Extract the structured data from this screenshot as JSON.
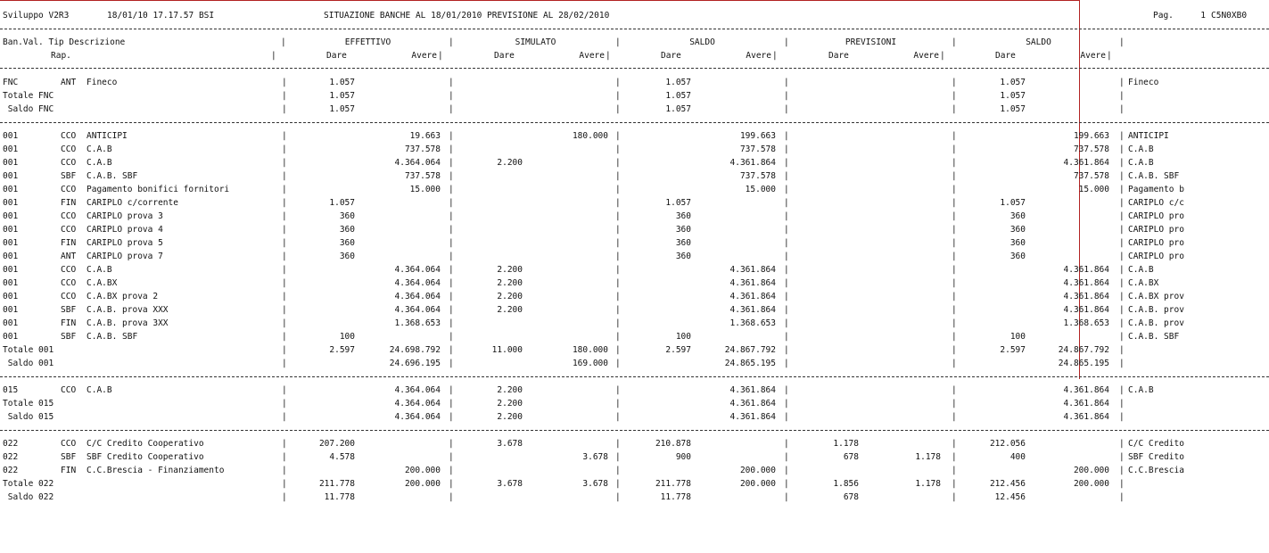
{
  "header": {
    "env": "Sviluppo V2R3",
    "datetime": "18/01/10 17.17.57 BSI",
    "title": "SITUAZIONE BANCHE AL 18/01/2010 PREVISIONE AL 28/02/2010",
    "page_label": "Pag.",
    "page_number": "1",
    "program_code": "C5N0XB0"
  },
  "columns": {
    "ban_val_tip_descr": "Ban.Val. Tip Descrizione",
    "rap": "Rap.",
    "effettivo": "EFFETTIVO",
    "simulato": "SIMULATO",
    "saldo1": "SALDO",
    "previsioni": "PREVISIONI",
    "saldo2": "SALDO",
    "dare": "Dare",
    "avere": "Avere"
  },
  "groups": [
    {
      "rows": [
        {
          "ban": "FNC",
          "tip": "ANT",
          "desc": "Fineco",
          "e_d": "1.057",
          "e_a": "",
          "s_d": "",
          "s_a": "",
          "sa_d": "1.057",
          "sa_a": "",
          "p_d": "",
          "p_a": "",
          "sb_d": "1.057",
          "sb_a": "",
          "note": "Fineco"
        },
        {
          "ban": "Totale FNC",
          "tip": "",
          "desc": "",
          "e_d": "1.057",
          "e_a": "",
          "s_d": "",
          "s_a": "",
          "sa_d": "1.057",
          "sa_a": "",
          "p_d": "",
          "p_a": "",
          "sb_d": "1.057",
          "sb_a": "",
          "note": ""
        },
        {
          "ban": " Saldo FNC",
          "tip": "",
          "desc": "",
          "e_d": "1.057",
          "e_a": "",
          "s_d": "",
          "s_a": "",
          "sa_d": "1.057",
          "sa_a": "",
          "p_d": "",
          "p_a": "",
          "sb_d": "1.057",
          "sb_a": "",
          "note": ""
        }
      ]
    },
    {
      "rows": [
        {
          "ban": "001",
          "tip": "CCO",
          "desc": "ANTICIPI",
          "e_d": "",
          "e_a": "19.663",
          "s_d": "",
          "s_a": "180.000",
          "sa_d": "",
          "sa_a": "199.663",
          "p_d": "",
          "p_a": "",
          "sb_d": "",
          "sb_a": "199.663",
          "note": "ANTICIPI"
        },
        {
          "ban": "001",
          "tip": "CCO",
          "desc": "C.A.B",
          "e_d": "",
          "e_a": "737.578",
          "s_d": "",
          "s_a": "",
          "sa_d": "",
          "sa_a": "737.578",
          "p_d": "",
          "p_a": "",
          "sb_d": "",
          "sb_a": "737.578",
          "note": "C.A.B"
        },
        {
          "ban": "001",
          "tip": "CCO",
          "desc": "C.A.B",
          "e_d": "",
          "e_a": "4.364.064",
          "s_d": "2.200",
          "s_a": "",
          "sa_d": "",
          "sa_a": "4.361.864",
          "p_d": "",
          "p_a": "",
          "sb_d": "",
          "sb_a": "4.361.864",
          "note": "C.A.B"
        },
        {
          "ban": "001",
          "tip": "SBF",
          "desc": "C.A.B. SBF",
          "e_d": "",
          "e_a": "737.578",
          "s_d": "",
          "s_a": "",
          "sa_d": "",
          "sa_a": "737.578",
          "p_d": "",
          "p_a": "",
          "sb_d": "",
          "sb_a": "737.578",
          "note": "C.A.B. SBF"
        },
        {
          "ban": "001",
          "tip": "CCO",
          "desc": "Pagamento bonifici fornitori",
          "e_d": "",
          "e_a": "15.000",
          "s_d": "",
          "s_a": "",
          "sa_d": "",
          "sa_a": "15.000",
          "p_d": "",
          "p_a": "",
          "sb_d": "",
          "sb_a": "15.000",
          "note": "Pagamento b"
        },
        {
          "ban": "001",
          "tip": "FIN",
          "desc": "CARIPLO c/corrente",
          "e_d": "1.057",
          "e_a": "",
          "s_d": "",
          "s_a": "",
          "sa_d": "1.057",
          "sa_a": "",
          "p_d": "",
          "p_a": "",
          "sb_d": "1.057",
          "sb_a": "",
          "note": "CARIPLO c/c"
        },
        {
          "ban": "001",
          "tip": "CCO",
          "desc": "CARIPLO prova 3",
          "e_d": "360",
          "e_a": "",
          "s_d": "",
          "s_a": "",
          "sa_d": "360",
          "sa_a": "",
          "p_d": "",
          "p_a": "",
          "sb_d": "360",
          "sb_a": "",
          "note": "CARIPLO pro"
        },
        {
          "ban": "001",
          "tip": "CCO",
          "desc": "CARIPLO prova 4",
          "e_d": "360",
          "e_a": "",
          "s_d": "",
          "s_a": "",
          "sa_d": "360",
          "sa_a": "",
          "p_d": "",
          "p_a": "",
          "sb_d": "360",
          "sb_a": "",
          "note": "CARIPLO pro"
        },
        {
          "ban": "001",
          "tip": "FIN",
          "desc": "CARIPLO prova 5",
          "e_d": "360",
          "e_a": "",
          "s_d": "",
          "s_a": "",
          "sa_d": "360",
          "sa_a": "",
          "p_d": "",
          "p_a": "",
          "sb_d": "360",
          "sb_a": "",
          "note": "CARIPLO pro"
        },
        {
          "ban": "001",
          "tip": "ANT",
          "desc": "CARIPLO prova 7",
          "e_d": "360",
          "e_a": "",
          "s_d": "",
          "s_a": "",
          "sa_d": "360",
          "sa_a": "",
          "p_d": "",
          "p_a": "",
          "sb_d": "360",
          "sb_a": "",
          "note": "CARIPLO pro"
        },
        {
          "ban": "001",
          "tip": "CCO",
          "desc": "C.A.B",
          "e_d": "",
          "e_a": "4.364.064",
          "s_d": "2.200",
          "s_a": "",
          "sa_d": "",
          "sa_a": "4.361.864",
          "p_d": "",
          "p_a": "",
          "sb_d": "",
          "sb_a": "4.361.864",
          "note": "C.A.B"
        },
        {
          "ban": "001",
          "tip": "CCO",
          "desc": "C.A.BX",
          "e_d": "",
          "e_a": "4.364.064",
          "s_d": "2.200",
          "s_a": "",
          "sa_d": "",
          "sa_a": "4.361.864",
          "p_d": "",
          "p_a": "",
          "sb_d": "",
          "sb_a": "4.361.864",
          "note": "C.A.BX"
        },
        {
          "ban": "001",
          "tip": "CCO",
          "desc": "C.A.BX prova 2",
          "e_d": "",
          "e_a": "4.364.064",
          "s_d": "2.200",
          "s_a": "",
          "sa_d": "",
          "sa_a": "4.361.864",
          "p_d": "",
          "p_a": "",
          "sb_d": "",
          "sb_a": "4.361.864",
          "note": "C.A.BX prov"
        },
        {
          "ban": "001",
          "tip": "SBF",
          "desc": "C.A.B. prova XXX",
          "e_d": "",
          "e_a": "4.364.064",
          "s_d": "2.200",
          "s_a": "",
          "sa_d": "",
          "sa_a": "4.361.864",
          "p_d": "",
          "p_a": "",
          "sb_d": "",
          "sb_a": "4.361.864",
          "note": "C.A.B. prov"
        },
        {
          "ban": "001",
          "tip": "FIN",
          "desc": "C.A.B. prova 3XX",
          "e_d": "",
          "e_a": "1.368.653",
          "s_d": "",
          "s_a": "",
          "sa_d": "",
          "sa_a": "1.368.653",
          "p_d": "",
          "p_a": "",
          "sb_d": "",
          "sb_a": "1.368.653",
          "note": "C.A.B. prov"
        },
        {
          "ban": "001",
          "tip": "SBF",
          "desc": "C.A.B. SBF",
          "e_d": "100",
          "e_a": "",
          "s_d": "",
          "s_a": "",
          "sa_d": "100",
          "sa_a": "",
          "p_d": "",
          "p_a": "",
          "sb_d": "100",
          "sb_a": "",
          "note": "C.A.B. SBF"
        },
        {
          "ban": "Totale 001",
          "tip": "",
          "desc": "",
          "e_d": "2.597",
          "e_a": "24.698.792",
          "s_d": "11.000",
          "s_a": "180.000",
          "sa_d": "2.597",
          "sa_a": "24.867.792",
          "p_d": "",
          "p_a": "",
          "sb_d": "2.597",
          "sb_a": "24.867.792",
          "note": ""
        },
        {
          "ban": " Saldo 001",
          "tip": "",
          "desc": "",
          "e_d": "",
          "e_a": "24.696.195",
          "s_d": "",
          "s_a": "169.000",
          "sa_d": "",
          "sa_a": "24.865.195",
          "p_d": "",
          "p_a": "",
          "sb_d": "",
          "sb_a": "24.865.195",
          "note": ""
        }
      ]
    },
    {
      "rows": [
        {
          "ban": "015",
          "tip": "CCO",
          "desc": "C.A.B",
          "e_d": "",
          "e_a": "4.364.064",
          "s_d": "2.200",
          "s_a": "",
          "sa_d": "",
          "sa_a": "4.361.864",
          "p_d": "",
          "p_a": "",
          "sb_d": "",
          "sb_a": "4.361.864",
          "note": "C.A.B"
        },
        {
          "ban": "Totale 015",
          "tip": "",
          "desc": "",
          "e_d": "",
          "e_a": "4.364.064",
          "s_d": "2.200",
          "s_a": "",
          "sa_d": "",
          "sa_a": "4.361.864",
          "p_d": "",
          "p_a": "",
          "sb_d": "",
          "sb_a": "4.361.864",
          "note": ""
        },
        {
          "ban": " Saldo 015",
          "tip": "",
          "desc": "",
          "e_d": "",
          "e_a": "4.364.064",
          "s_d": "2.200",
          "s_a": "",
          "sa_d": "",
          "sa_a": "4.361.864",
          "p_d": "",
          "p_a": "",
          "sb_d": "",
          "sb_a": "4.361.864",
          "note": ""
        }
      ]
    },
    {
      "rows": [
        {
          "ban": "022",
          "tip": "CCO",
          "desc": "C/C Credito Cooperativo",
          "e_d": "207.200",
          "e_a": "",
          "s_d": "3.678",
          "s_a": "",
          "sa_d": "210.878",
          "sa_a": "",
          "p_d": "1.178",
          "p_a": "",
          "sb_d": "212.056",
          "sb_a": "",
          "note": "C/C Credito"
        },
        {
          "ban": "022",
          "tip": "SBF",
          "desc": "SBF Credito Cooperativo",
          "e_d": "4.578",
          "e_a": "",
          "s_d": "",
          "s_a": "3.678",
          "sa_d": "900",
          "sa_a": "",
          "p_d": "678",
          "p_a": "1.178",
          "sb_d": "400",
          "sb_a": "",
          "note": "SBF Credito"
        },
        {
          "ban": "022",
          "tip": "FIN",
          "desc": "C.C.Brescia - Finanziamento",
          "e_d": "",
          "e_a": "200.000",
          "s_d": "",
          "s_a": "",
          "sa_d": "",
          "sa_a": "200.000",
          "p_d": "",
          "p_a": "",
          "sb_d": "",
          "sb_a": "200.000",
          "note": "C.C.Brescia"
        },
        {
          "ban": "Totale 022",
          "tip": "",
          "desc": "",
          "e_d": "211.778",
          "e_a": "200.000",
          "s_d": "3.678",
          "s_a": "3.678",
          "sa_d": "211.778",
          "sa_a": "200.000",
          "p_d": "1.856",
          "p_a": "1.178",
          "sb_d": "212.456",
          "sb_a": "200.000",
          "note": ""
        },
        {
          "ban": " Saldo 022",
          "tip": "",
          "desc": "",
          "e_d": "11.778",
          "e_a": "",
          "s_d": "",
          "s_a": "",
          "sa_d": "11.778",
          "sa_a": "",
          "p_d": "678",
          "p_a": "",
          "sb_d": "12.456",
          "sb_a": "",
          "note": ""
        }
      ]
    }
  ]
}
